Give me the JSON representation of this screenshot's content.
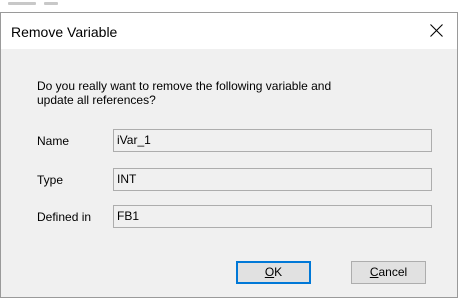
{
  "dialog": {
    "title": "Remove Variable",
    "message_line1": "Do you really want to remove the following variable and",
    "message_line2": "update all references?",
    "fields": [
      {
        "label": "Name",
        "value": "iVar_1"
      },
      {
        "label": "Type",
        "value": "INT"
      },
      {
        "label": "Defined in",
        "value": "FB1"
      }
    ],
    "buttons": {
      "ok": {
        "mnemonic": "O",
        "rest": "K"
      },
      "cancel": {
        "mnemonic": "C",
        "rest": "ancel"
      }
    }
  },
  "icons": {
    "close": "close-icon"
  },
  "colors": {
    "dialog_background": "#f0f0f0",
    "titlebar_background": "#ffffff",
    "default_button_border": "#0078d7",
    "button_face": "#e1e1e1"
  }
}
